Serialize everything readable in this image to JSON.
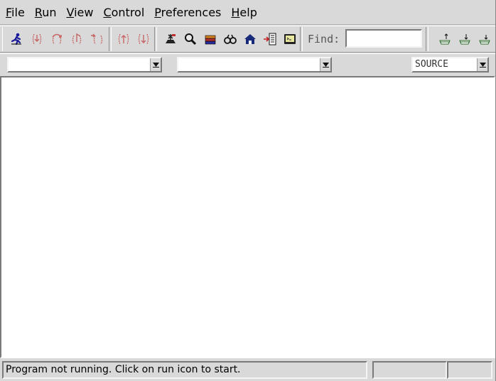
{
  "menubar": {
    "items": [
      {
        "mnemonic": "F",
        "rest": "ile"
      },
      {
        "mnemonic": "R",
        "rest": "un"
      },
      {
        "mnemonic": "V",
        "rest": "iew"
      },
      {
        "mnemonic": "C",
        "rest": "ontrol"
      },
      {
        "mnemonic": "P",
        "rest": "references"
      },
      {
        "mnemonic": "H",
        "rest": "elp"
      }
    ]
  },
  "toolbar": {
    "find_label": "Find:",
    "find_value": "",
    "icons": [
      "run-icon",
      "step-icon",
      "next-icon",
      "until-icon",
      "finish-icon",
      "up-icon",
      "down-icon",
      "breakpoint-icon",
      "search-icon",
      "stack-icon",
      "watch-icon",
      "home-icon",
      "goto-line-icon",
      "console-icon",
      "stack-up-icon",
      "stack-down-icon",
      "stack-current-icon"
    ],
    "colors": {
      "accent_blue": "#1a1a9a",
      "disabled_red": "#c86464"
    }
  },
  "selectors": {
    "file_combo": "",
    "function_combo": "",
    "mode_combo": "SOURCE"
  },
  "status": {
    "message": "Program not running. Click on run icon to start.",
    "cell1": "",
    "cell2": ""
  }
}
